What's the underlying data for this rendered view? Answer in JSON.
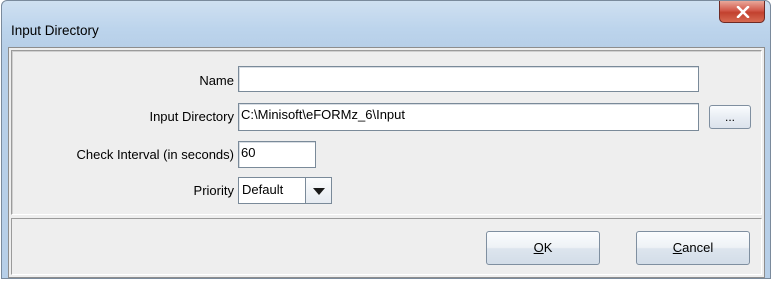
{
  "window": {
    "title": "Input Directory",
    "close_icon": "close-x-icon"
  },
  "form": {
    "name": {
      "label": "Name",
      "value": ""
    },
    "input_directory": {
      "label": "Input Directory",
      "value": "C:\\Minisoft\\eFORMz_6\\Input",
      "browse_label": "..."
    },
    "check_interval": {
      "label": "Check Interval (in seconds)",
      "value": "60"
    },
    "priority": {
      "label": "Priority",
      "value": "Default",
      "arrow_icon": "chevron-down-icon"
    }
  },
  "buttons": {
    "ok": {
      "mnemonic": "O",
      "rest": "K"
    },
    "cancel": {
      "mnemonic": "C",
      "rest": "ancel"
    }
  }
}
